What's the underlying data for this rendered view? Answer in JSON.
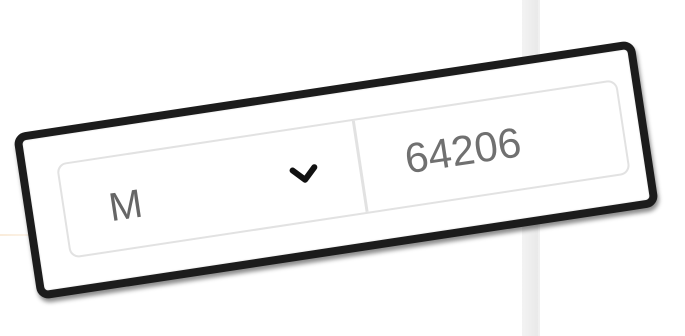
{
  "form": {
    "state_select": {
      "selected": "M",
      "icon": "chevron-down-icon"
    },
    "zip_input": {
      "value": "64206"
    }
  },
  "colors": {
    "frame": "#1c1c1c",
    "field_border": "#e2e2e2",
    "text": "#666666"
  }
}
